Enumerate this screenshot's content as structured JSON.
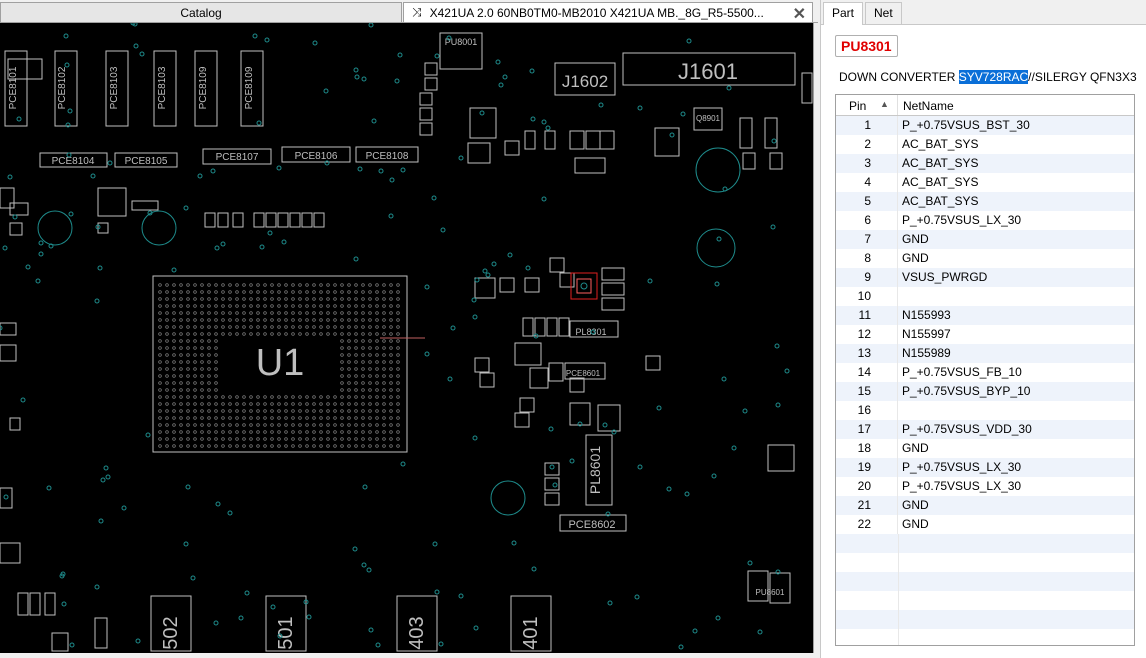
{
  "tabs": {
    "catalog": "Catalog",
    "document": "X421UA 2.0 60NB0TM0-MB2010 X421UA MB._8G_R5-5500..."
  },
  "board_labels": {
    "pu8001": "PU8001",
    "j1602": "J1602",
    "j1601": "J1601",
    "q8901": "Q8901",
    "pce8104": "PCE8104",
    "pce8105": "PCE8105",
    "pce8107": "PCE8107",
    "pce8106": "PCE8106",
    "pce8108": "PCE8108",
    "pce8109": "PCE8109",
    "pce8102": "PCE8102",
    "pce8103": "PCE8103",
    "pce8101": "PCE8101",
    "u1": "U1",
    "pl8301": "PL8301",
    "pl8601": "PL8601",
    "pce8601": "PCE8601",
    "pce8602": "PCE8602",
    "pu8601": "PU8601",
    "r502": "502",
    "r501": "501",
    "r403": "403",
    "r401": "401"
  },
  "right_panel": {
    "tabs": {
      "part": "Part",
      "net": "Net"
    },
    "part_name": "PU8301",
    "description": {
      "prefix": "DOWN CONVERTER ",
      "highlight": "SYV728RAC",
      "suffix": "//SILERGY QFN3X3"
    },
    "columns": {
      "pin": "Pin",
      "net": "NetName"
    },
    "pins": [
      {
        "pin": "1",
        "net": "P_+0.75VSUS_BST_30"
      },
      {
        "pin": "2",
        "net": "AC_BAT_SYS"
      },
      {
        "pin": "3",
        "net": "AC_BAT_SYS"
      },
      {
        "pin": "4",
        "net": "AC_BAT_SYS"
      },
      {
        "pin": "5",
        "net": "AC_BAT_SYS"
      },
      {
        "pin": "6",
        "net": "P_+0.75VSUS_LX_30"
      },
      {
        "pin": "7",
        "net": "GND"
      },
      {
        "pin": "8",
        "net": "GND"
      },
      {
        "pin": "9",
        "net": "VSUS_PWRGD"
      },
      {
        "pin": "10",
        "net": ""
      },
      {
        "pin": "11",
        "net": "N155993"
      },
      {
        "pin": "12",
        "net": "N155997"
      },
      {
        "pin": "13",
        "net": "N155989"
      },
      {
        "pin": "14",
        "net": "P_+0.75VSUS_FB_10"
      },
      {
        "pin": "15",
        "net": "P_+0.75VSUS_BYP_10"
      },
      {
        "pin": "16",
        "net": ""
      },
      {
        "pin": "17",
        "net": "P_+0.75VSUS_VDD_30"
      },
      {
        "pin": "18",
        "net": "GND"
      },
      {
        "pin": "19",
        "net": "P_+0.75VSUS_LX_30"
      },
      {
        "pin": "20",
        "net": "P_+0.75VSUS_LX_30"
      },
      {
        "pin": "21",
        "net": "GND"
      },
      {
        "pin": "22",
        "net": "GND"
      }
    ]
  },
  "colors": {
    "board_bg": "#000000",
    "silk": "#bfbfbf",
    "via": "#1e8c8c",
    "selected": "#e02020",
    "highlight": "#0a6fd8"
  }
}
